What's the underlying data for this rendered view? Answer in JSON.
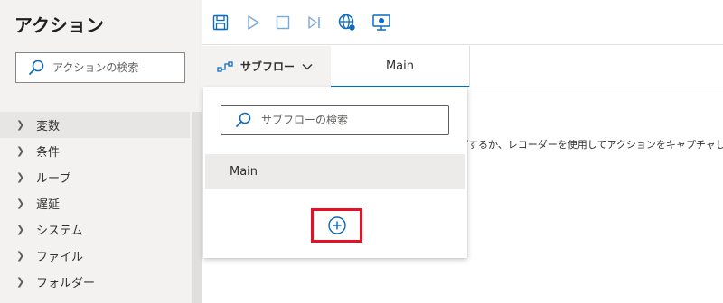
{
  "actions_pane": {
    "title": "アクション",
    "search_placeholder": "アクションの検索",
    "categories": [
      {
        "label": "変数"
      },
      {
        "label": "条件"
      },
      {
        "label": "ループ"
      },
      {
        "label": "遅延"
      },
      {
        "label": "システム"
      },
      {
        "label": "ファイル"
      },
      {
        "label": "フォルダー"
      }
    ]
  },
  "toolbar": {
    "buttons": [
      {
        "icon": "save-icon"
      },
      {
        "icon": "run-icon"
      },
      {
        "icon": "stop-icon"
      },
      {
        "icon": "run-next-action-icon"
      },
      {
        "icon": "web-recorder-icon"
      },
      {
        "icon": "desktop-recorder-icon"
      }
    ]
  },
  "tabs": {
    "subflows_label": "サブフロー",
    "main_label": "Main"
  },
  "canvas": {
    "hint_text": "ップするか、レコーダーを使用してアクションをキャプチャしま"
  },
  "subflow_panel": {
    "search_placeholder": "サブフローの検索",
    "items": [
      {
        "label": "Main"
      }
    ],
    "add_icon": "add-circle-icon"
  },
  "colors": {
    "accent": "#0f6cbd",
    "highlight_frame": "#e81123"
  }
}
